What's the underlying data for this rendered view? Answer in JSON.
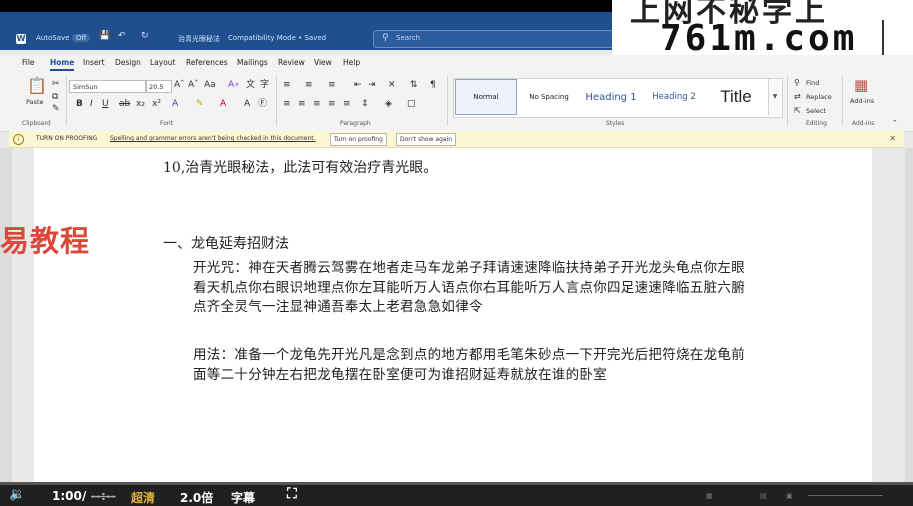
{
  "titlebar": {
    "autosave_label": "AutoSave",
    "autosave_state": "Off",
    "doc_title": "治青光眼秘法",
    "compat_label": "Compatibility Mode • Saved",
    "search_placeholder": "Search"
  },
  "watermark": {
    "top_text": "上网不秘学上",
    "main_text": "761m.com"
  },
  "menu": [
    "File",
    "Home",
    "Insert",
    "Design",
    "Layout",
    "References",
    "Mailings",
    "Review",
    "View",
    "Help"
  ],
  "ribbon": {
    "paste_label": "Paste",
    "clipboard_label": "Clipboard",
    "font_name": "SimSun",
    "font_size": "20.5",
    "font_label": "Font",
    "paragraph_label": "Paragraph",
    "styles_label": "Styles",
    "styles": [
      "Normal",
      "No Spacing",
      "Heading 1",
      "Heading 2",
      "Title"
    ],
    "find_label": "Find",
    "replace_label": "Replace",
    "select_label": "Select",
    "editing_label": "Editing",
    "addins_label": "Add-ins",
    "addins_group_label": "Add-ins"
  },
  "notification": {
    "title": "TURN ON PROOFING",
    "message": "Spelling and grammar errors aren't being checked in this document.",
    "button_on": "Turn on proofing",
    "button_dismiss": "Don't show again"
  },
  "overlay_brand": "易教程",
  "document": {
    "line10": "10,治青光眼秘法，此法可有效治疗青光眼。",
    "heading": "一、龙龟延寿招财法",
    "para1": "开光咒：神在天者腾云驾雾在地者走马车龙弟子拜请速速降临扶持弟子开光龙头龟点你左眼看天机点你右眼识地理点你左耳能听万人语点你右耳能听万人言点你四足速速降临五脏六腑点齐全灵气一注显神通吾奉太上老君急急如律令",
    "para2": "用法：准备一个龙龟先开光凡是念到点的地方都用毛笔朱砂点一下开完光后把符烧在龙龟前面等二十分钟左右把龙龟摆在卧室便可为谁招财延寿就放在谁的卧室"
  },
  "player": {
    "time": "1:00",
    "separator": "/",
    "duration": "--:--",
    "quality": "超清",
    "speed": "2.0倍",
    "subtitles": "字幕",
    "progress": 0.0
  },
  "colors": {
    "titlebar": "#1f4f8f",
    "accent_quality": "#e2b23c",
    "brand_overlay": "#d94a3a"
  }
}
